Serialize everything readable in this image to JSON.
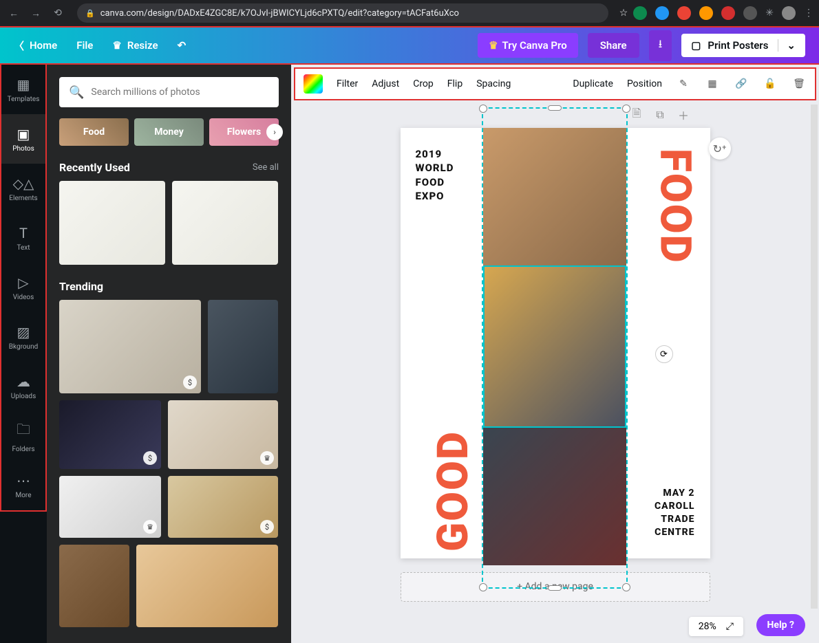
{
  "browser": {
    "url": "canva.com/design/DADxE4ZGC8E/k7OJvI-jBWICYLjd6cPXTQ/edit?category=tACFat6uXco"
  },
  "topbar": {
    "home": "Home",
    "file": "File",
    "resize": "Resize",
    "try_pro": "Try Canva Pro",
    "share": "Share",
    "print": "Print Posters"
  },
  "rail": {
    "items": [
      {
        "label": "Templates"
      },
      {
        "label": "Photos"
      },
      {
        "label": "Elements"
      },
      {
        "label": "Text"
      },
      {
        "label": "Videos"
      },
      {
        "label": "Bkground"
      },
      {
        "label": "Uploads"
      },
      {
        "label": "Folders"
      },
      {
        "label": "More"
      }
    ]
  },
  "panel": {
    "search_placeholder": "Search millions of photos",
    "categories": [
      "Food",
      "Money",
      "Flowers"
    ],
    "recent_title": "Recently Used",
    "see_all": "See all",
    "trending_title": "Trending"
  },
  "toolbar": {
    "filter": "Filter",
    "adjust": "Adjust",
    "crop": "Crop",
    "flip": "Flip",
    "spacing": "Spacing",
    "duplicate": "Duplicate",
    "position": "Position"
  },
  "poster": {
    "top_left_1": "2019",
    "top_left_2": "WORLD",
    "top_left_3": "FOOD",
    "top_left_4": "EXPO",
    "big_food": "FOOD",
    "big_good": "GOOD",
    "br_1": "MAY 2",
    "br_2": "CAROLL",
    "br_3": "TRADE",
    "br_4": "CENTRE"
  },
  "addpage": "+ Add a new page",
  "zoom": "28%",
  "help": "Help ?"
}
